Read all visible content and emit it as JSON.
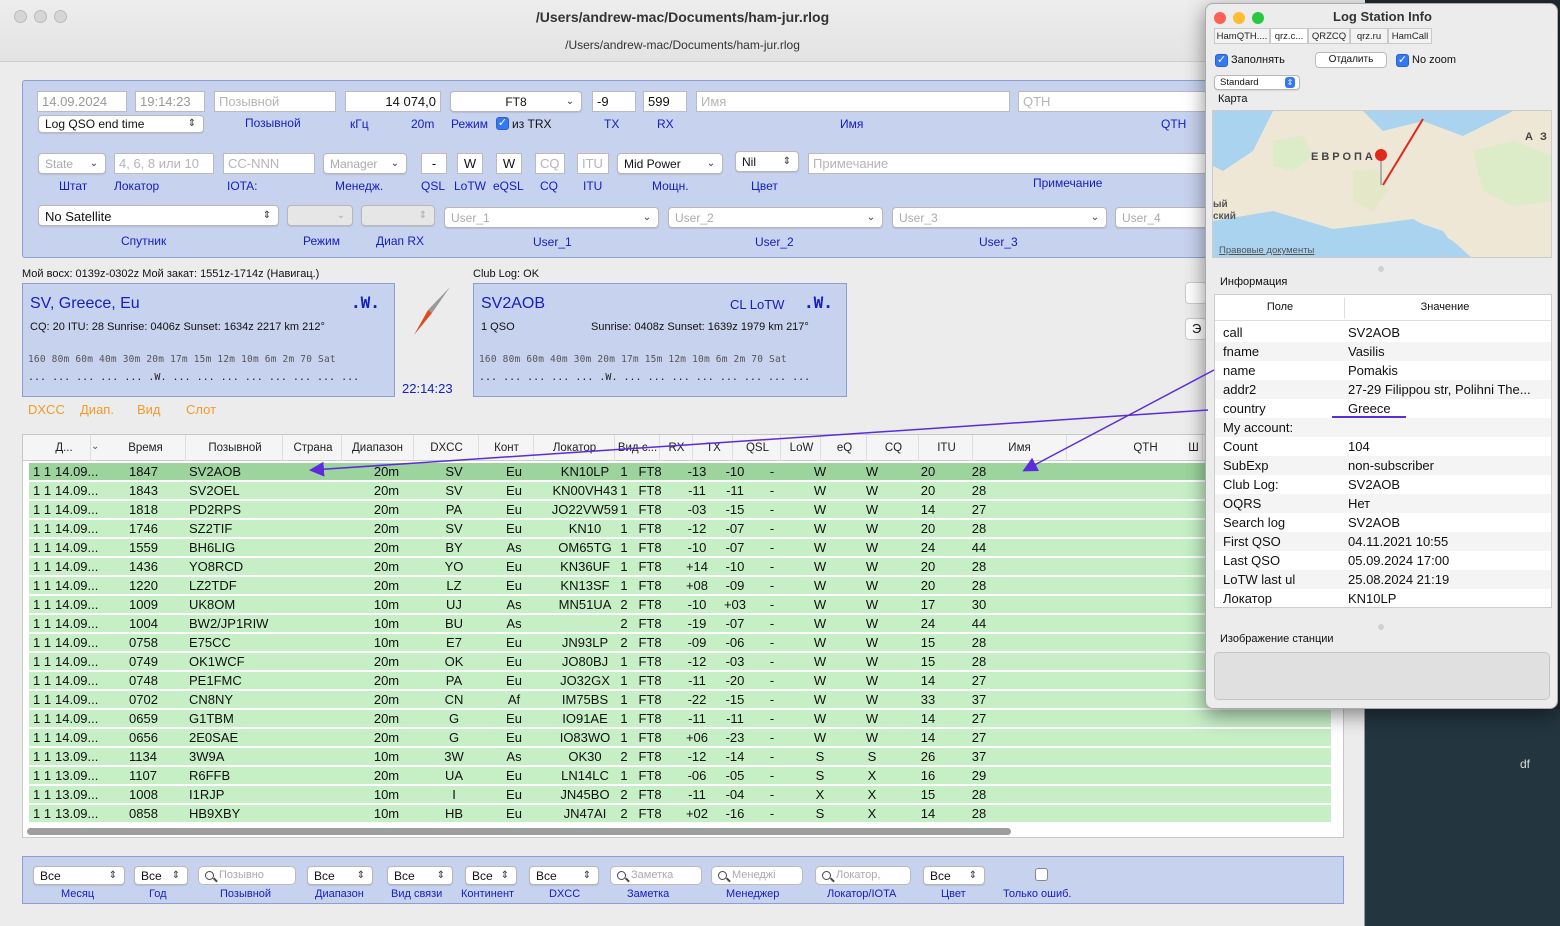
{
  "window": {
    "title": "/Users/andrew-mac/Documents/ham-jur.rlog",
    "subtitle": "/Users/andrew-mac/Documents/ham-jur.rlog"
  },
  "form": {
    "date": "14.09.2024",
    "time": "19:14:23",
    "callsign_placeholder": "Позывной",
    "freq": "14 074,0",
    "mode": "FT8",
    "tx": "-9",
    "rx": "599",
    "name_placeholder": "Имя",
    "qth_placeholder": "QTH",
    "end_time_select": "Log QSO end time",
    "labels": {
      "callsign": "Позывной",
      "khz": "кГц",
      "band": "20m",
      "mode": "Режим",
      "from_trx": "из TRX",
      "tx": "TX",
      "rx": "RX",
      "name": "Имя",
      "qth": "QTH"
    },
    "state_select": "State",
    "locator_placeholder": "4, 6, 8 или 10",
    "iota_placeholder": "CC-NNN",
    "manager_select": "Manager",
    "qsl_value": "-",
    "lotw_value": "W",
    "eqsl_value": "W",
    "cq_placeholder": "CQ",
    "itu_placeholder": "ITU",
    "power_select": "Mid Power",
    "color_select": "Nil",
    "note_placeholder": "Примечание",
    "labels2": {
      "state": "Штат",
      "locator": "Локатор",
      "iota": "IOTA:",
      "manager": "Менедж.",
      "qsl": "QSL",
      "lotw": "LoTW",
      "eqsl": "eQSL",
      "cq": "CQ",
      "itu": "ITU",
      "power": "Мощн.",
      "color": "Цвет",
      "note": "Примечание"
    },
    "satellite_select": "No Satellite",
    "user1_placeholder": "User_1",
    "user2_placeholder": "User_2",
    "user3_placeholder": "User_3",
    "user4_placeholder": "User_4",
    "labels3": {
      "satellite": "Спутник",
      "sat_mode": "Режим",
      "rx_band": "Диап RX",
      "user1": "User_1",
      "user2": "User_2",
      "user3": "User_3"
    }
  },
  "sun": {
    "my_text": "Мой восх: 0139z-0302z  Мой закат: 1551z-1714z (Навигац.)",
    "clublog_text": "Club Log: OK",
    "clock": "22:14:23"
  },
  "dxcc_panel": {
    "title": "SV, Greece, Eu",
    "badge": ".W.",
    "info": "CQ: 20  ITU: 28  Sunrise: 0406z  Sunset: 1634z  2217 km  212°",
    "bands": "160  80m  60m  40m  30m  20m  17m  15m  12m  10m   6m   2m   70  Sat",
    "dots": "...  ...  ...  ...  ...  .W.  ...  ...  ...  ...  ...  ...  ...  ..."
  },
  "call_panel": {
    "title": "SV2AOB",
    "cl": "CL LoTW",
    "badge": ".W.",
    "qso": "1 QSO",
    "info": "Sunrise: 0408z  Sunset: 1639z  1979 km  217°",
    "bands": "160  80m  60m  40m  30m  20m  17m  15m  12m  10m   6m   2m   70  Sat",
    "dots": "...  ...  ...  ...  ...  .W.  ...  ...  ...  ...  ...  ...  ...  ..."
  },
  "stats_tabs": {
    "dxcc": "DXCC",
    "band": "Диап.",
    "mode": "Вид",
    "slot": "Слот"
  },
  "grid": {
    "headers": [
      "Д...",
      "Время",
      "Позывной",
      "Страна",
      "Диапазон",
      "DXCC",
      "Конт",
      "Локатор",
      "Вид с...",
      "RX",
      "TX",
      "QSL",
      "LoW",
      "eQ",
      "CQ",
      "ITU",
      "Имя",
      "QTH",
      "Ш"
    ],
    "rows": [
      [
        "1 1",
        "14.09...",
        "1847",
        "SV2AOB",
        "20m",
        "SV",
        "Eu",
        "KN10LP",
        "1",
        "FT8",
        "-13",
        "-10",
        "-",
        "W",
        "W",
        "20",
        "28"
      ],
      [
        "1 1",
        "14.09...",
        "1843",
        "SV2OEL",
        "20m",
        "SV",
        "Eu",
        "KN00VH43",
        "1",
        "FT8",
        "-11",
        "-11",
        "-",
        "W",
        "W",
        "20",
        "28"
      ],
      [
        "1 1",
        "14.09...",
        "1818",
        "PD2RPS",
        "20m",
        "PA",
        "Eu",
        "JO22VW59",
        "1",
        "FT8",
        "-03",
        "-15",
        "-",
        "W",
        "W",
        "14",
        "27"
      ],
      [
        "1 1",
        "14.09...",
        "1746",
        "SZ2TIF",
        "20m",
        "SV",
        "Eu",
        "KN10",
        "1",
        "FT8",
        "-12",
        "-07",
        "-",
        "W",
        "W",
        "20",
        "28"
      ],
      [
        "1 1",
        "14.09...",
        "1559",
        "BH6LIG",
        "20m",
        "BY",
        "As",
        "OM65TG",
        "1",
        "FT8",
        "-10",
        "-07",
        "-",
        "W",
        "W",
        "24",
        "44"
      ],
      [
        "1 1",
        "14.09...",
        "1436",
        "YO8RCD",
        "20m",
        "YO",
        "Eu",
        "KN36UF",
        "1",
        "FT8",
        "+14",
        "-10",
        "-",
        "W",
        "W",
        "20",
        "28"
      ],
      [
        "1 1",
        "14.09...",
        "1220",
        "LZ2TDF",
        "20m",
        "LZ",
        "Eu",
        "KN13SF",
        "1",
        "FT8",
        "+08",
        "-09",
        "-",
        "W",
        "W",
        "20",
        "28"
      ],
      [
        "1 1",
        "14.09...",
        "1009",
        "UK8OM",
        "10m",
        "UJ",
        "As",
        "MN51UA",
        "2",
        "FT8",
        "-10",
        "+03",
        "-",
        "W",
        "W",
        "17",
        "30"
      ],
      [
        "1 1",
        "14.09...",
        "1004",
        "BW2/JP1RIW",
        "10m",
        "BU",
        "As",
        "",
        "2",
        "FT8",
        "-19",
        "-07",
        "-",
        "W",
        "W",
        "24",
        "44"
      ],
      [
        "1 1",
        "14.09...",
        "0758",
        "E75CC",
        "10m",
        "E7",
        "Eu",
        "JN93LP",
        "2",
        "FT8",
        "-09",
        "-06",
        "-",
        "W",
        "W",
        "15",
        "28"
      ],
      [
        "1 1",
        "14.09...",
        "0749",
        "OK1WCF",
        "20m",
        "OK",
        "Eu",
        "JO80BJ",
        "1",
        "FT8",
        "-12",
        "-03",
        "-",
        "W",
        "W",
        "15",
        "28"
      ],
      [
        "1 1",
        "14.09...",
        "0748",
        "PE1FMC",
        "20m",
        "PA",
        "Eu",
        "JO32GX",
        "1",
        "FT8",
        "-11",
        "-20",
        "-",
        "W",
        "W",
        "14",
        "27"
      ],
      [
        "1 1",
        "14.09...",
        "0702",
        "CN8NY",
        "20m",
        "CN",
        "Af",
        "IM75BS",
        "1",
        "FT8",
        "-22",
        "-15",
        "-",
        "W",
        "W",
        "33",
        "37"
      ],
      [
        "1 1",
        "14.09...",
        "0659",
        "G1TBM",
        "20m",
        "G",
        "Eu",
        "IO91AE",
        "1",
        "FT8",
        "-11",
        "-11",
        "-",
        "W",
        "W",
        "14",
        "27"
      ],
      [
        "1 1",
        "14.09...",
        "0656",
        "2E0SAE",
        "20m",
        "G",
        "Eu",
        "IO83WO",
        "1",
        "FT8",
        "+06",
        "-23",
        "-",
        "W",
        "W",
        "14",
        "27"
      ],
      [
        "1 1",
        "13.09...",
        "1134",
        "3W9A",
        "10m",
        "3W",
        "As",
        "OK30",
        "2",
        "FT8",
        "-12",
        "-14",
        "-",
        "S",
        "S",
        "26",
        "37"
      ],
      [
        "1 1",
        "13.09...",
        "1107",
        "R6FFB",
        "20m",
        "UA",
        "Eu",
        "LN14LC",
        "1",
        "FT8",
        "-06",
        "-05",
        "-",
        "S",
        "X",
        "16",
        "29"
      ],
      [
        "1 1",
        "13.09...",
        "1008",
        "I1RJP",
        "10m",
        "I",
        "Eu",
        "JN45BO",
        "2",
        "FT8",
        "-11",
        "-04",
        "-",
        "X",
        "X",
        "15",
        "28"
      ],
      [
        "1 1",
        "13.09...",
        "0858",
        "HB9XBY",
        "10m",
        "HB",
        "Eu",
        "JN47AI",
        "2",
        "FT8",
        "+02",
        "-16",
        "-",
        "S",
        "X",
        "14",
        "28"
      ]
    ]
  },
  "filters": {
    "month": "Все",
    "year": "Все",
    "call_ph": "Позывно",
    "band": "Все",
    "mode": "Все",
    "cont": "Все",
    "dxcc": "Все",
    "note_ph": "Заметка",
    "manager_ph": "Менеджі",
    "loc_ph": "Локатор,",
    "color": "Все",
    "labels": {
      "month": "Месяц",
      "year": "Год",
      "call": "Позывной",
      "band": "Диапазон",
      "mode": "Вид связи",
      "cont": "Континент",
      "dxcc": "DXCC",
      "note": "Заметка",
      "manager": "Менеджер",
      "loc": "Локатор/IOTA",
      "color": "Цвет",
      "errors": "Только ошиб."
    }
  },
  "info_window": {
    "title": "Log Station Info",
    "tabs": [
      "HamQTH....",
      "qrz.c...",
      "QRZCQ",
      "qrz.ru",
      "HamCall"
    ],
    "fill_label": "Заполнять",
    "zoom_out": "Отдалить",
    "no_zoom": "No zoom",
    "map_type": "Standard",
    "map_label": "Карта",
    "map_region": "ЕВРОПА",
    "map_sea": "ый\nский",
    "map_az": "А З",
    "legal": "Правовые документы",
    "info_label": "Информация",
    "col_field": "Поле",
    "col_value": "Значение",
    "rows": [
      [
        "call",
        "SV2AOB"
      ],
      [
        "fname",
        "Vasilis"
      ],
      [
        "name",
        "Pomakis"
      ],
      [
        "addr2",
        "27-29 Filippou str, Polihni The..."
      ],
      [
        "country",
        "Greece"
      ],
      [
        "My account:",
        ""
      ],
      [
        "Count",
        "104"
      ],
      [
        "SubExp",
        "non-subscriber"
      ],
      [
        "Club Log:",
        "SV2AOB"
      ],
      [
        "OQRS",
        "Нет"
      ],
      [
        "Search log",
        "SV2AOB"
      ],
      [
        "First QSO",
        "04.11.2021 10:55"
      ],
      [
        "Last QSO",
        "05.09.2024 17:00"
      ],
      [
        "LoTW last ul",
        "25.08.2024 21:19"
      ],
      [
        "Локатор",
        "KN10LP"
      ]
    ],
    "image_label": "Изображение станции"
  },
  "misc": {
    "right_partial": "df",
    "btn_partial": "Э"
  }
}
